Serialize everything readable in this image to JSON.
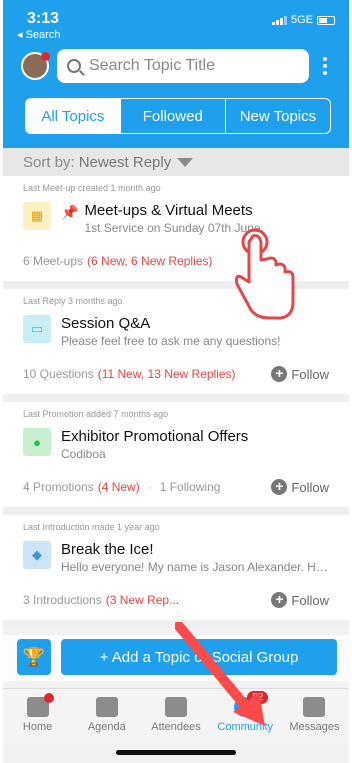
{
  "status": {
    "time": "3:13",
    "back_label": "◂ Search",
    "carrier": "5GE"
  },
  "search": {
    "placeholder": "Search Topic Title"
  },
  "tabs": [
    {
      "label": "All Topics",
      "active": true
    },
    {
      "label": "Followed",
      "active": false
    },
    {
      "label": "New Topics",
      "active": false
    }
  ],
  "sort": {
    "prefix": "Sort by:",
    "value": "Newest Reply"
  },
  "topics": [
    {
      "meta": "Last Meet-up created 1 month ago",
      "title": "Meet-ups & Virtual Meets",
      "subtitle": "1st Service on Sunday 07th June.",
      "count": "6 Meet-ups",
      "new": "(6 New, 6 New Replies)",
      "icon": "calendar-icon",
      "icon_color": "#f6c945"
    },
    {
      "meta": "Last Reply 3 months ago",
      "title": "Session Q&A",
      "subtitle": "Please feel free to ask me any questions!",
      "count": "10 Questions",
      "new": "(11 New, 13 New Replies)",
      "follow": "Follow",
      "icon": "chat-icon",
      "icon_color": "#3dbfd9"
    },
    {
      "meta": "Last Promotion added 7 months ago",
      "title": "Exhibitor Promotional Offers",
      "subtitle": "Codiboa",
      "count": "4 Promotions",
      "new": "(4 New)",
      "sep": "·",
      "following": "1 Following",
      "follow": "Follow",
      "icon": "promo-icon",
      "icon_color": "#2dbd4a"
    },
    {
      "meta": "Last Introduction made 1 year ago",
      "title": "Break the Ice!",
      "subtitle": "Hello everyone! My name is Jason Alexander. Ha...",
      "count": "3 Introductions",
      "new": "(3 New Rep...",
      "follow": "Follow",
      "icon": "ice-icon",
      "icon_color": "#3a9ad9"
    }
  ],
  "action": {
    "add_label": "+ Add a Topic or Social Group"
  },
  "tabbar": [
    {
      "label": "Home",
      "icon": "home-icon"
    },
    {
      "label": "Agenda",
      "icon": "agenda-icon"
    },
    {
      "label": "Attendees",
      "icon": "attendees-icon"
    },
    {
      "label": "Community",
      "icon": "community-icon",
      "badge": "82",
      "active": true
    },
    {
      "label": "Messages",
      "icon": "messages-icon"
    }
  ]
}
